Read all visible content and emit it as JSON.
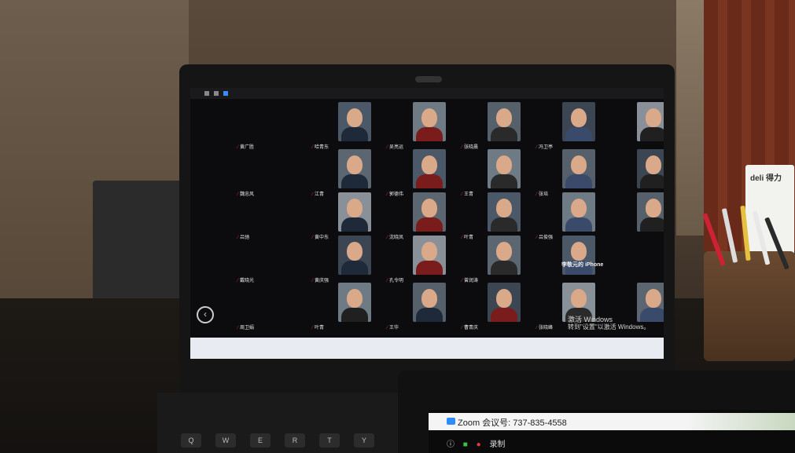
{
  "zoom": {
    "meeting_id_label": "Zoom 会议号: 737-835-4558",
    "record_label": "录制",
    "iphone_device": "李敬元的 iPhone"
  },
  "windows": {
    "activate_title": "激活 Windows",
    "activate_sub": "转到\"设置\"以激活 Windows。"
  },
  "keyboard_keys": [
    "Q",
    "W",
    "E",
    "R",
    "T",
    "Y"
  ],
  "participants": [
    {
      "name": "黄广胜"
    },
    {
      "name": "哈青东"
    },
    {
      "name": "吴亮运"
    },
    {
      "name": "张晓晨"
    },
    {
      "name": "冯卫亭"
    },
    {
      "name": "魏忠风"
    },
    {
      "name": "江青"
    },
    {
      "name": "郭德伟"
    },
    {
      "name": "王青"
    },
    {
      "name": "张培"
    },
    {
      "name": "吕驰"
    },
    {
      "name": "黄中东"
    },
    {
      "name": "沈晓凤"
    },
    {
      "name": "叶青"
    },
    {
      "name": "吕俊强"
    },
    {
      "name": "戴晓光"
    },
    {
      "name": "黄庆强"
    },
    {
      "name": "孔令明"
    },
    {
      "name": "曾润涛"
    },
    {
      "name": "周卫娟"
    },
    {
      "name": "叶青"
    },
    {
      "name": "王华"
    },
    {
      "name": "曹青庆"
    },
    {
      "name": "张晓峰"
    }
  ],
  "colors": {
    "zoom_blue": "#2d8cff",
    "mic_muted_red": "#e03030",
    "lock_green": "#3bc24a",
    "record_red": "#e53b3b"
  },
  "brands": {
    "pencil_box": "deli 得力"
  }
}
